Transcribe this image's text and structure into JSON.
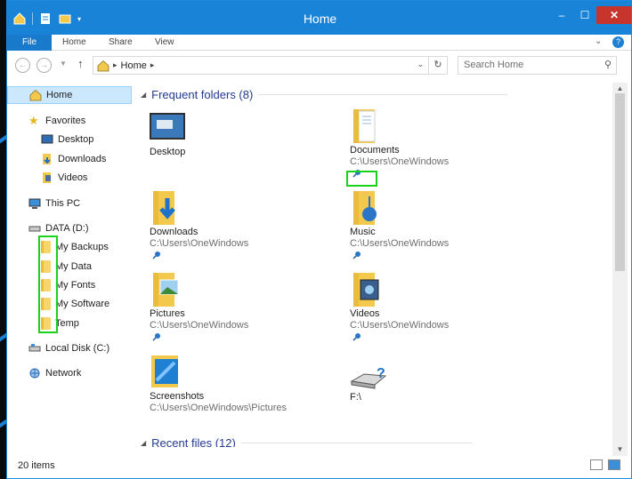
{
  "window": {
    "title": "Home",
    "controls": {
      "minimize": "–",
      "maximize": "☐",
      "close": "✕"
    }
  },
  "ribbon": {
    "tabs": [
      "File",
      "Home",
      "Share",
      "View"
    ],
    "help": "?"
  },
  "address": {
    "crumb": "Home",
    "search_placeholder": "Search Home"
  },
  "nav": {
    "items": [
      {
        "label": "Home",
        "icon": "home-icon",
        "selected": true
      },
      {
        "label": "Favorites",
        "icon": "star-icon"
      },
      {
        "label": "Desktop",
        "icon": "desktop-icon"
      },
      {
        "label": "Downloads",
        "icon": "downloads-folder-icon"
      },
      {
        "label": "Videos",
        "icon": "videos-folder-icon"
      },
      {
        "label": "This PC",
        "icon": "computer-icon"
      },
      {
        "label": "DATA (D:)",
        "icon": "drive-icon"
      },
      {
        "label": "My Backups",
        "icon": "folder-icon"
      },
      {
        "label": "My Data",
        "icon": "folder-icon"
      },
      {
        "label": "My Fonts",
        "icon": "folder-icon"
      },
      {
        "label": "My Software",
        "icon": "folder-icon"
      },
      {
        "label": "Temp",
        "icon": "folder-icon"
      },
      {
        "label": "Local Disk (C:)",
        "icon": "drive-icon"
      },
      {
        "label": "Network",
        "icon": "network-icon"
      }
    ]
  },
  "content": {
    "frequent_header": "Frequent folders (8)",
    "recent_header": "Recent files (12)",
    "tiles": [
      {
        "name": "Desktop",
        "path": "",
        "pinned": false,
        "icon": "desktop-icon"
      },
      {
        "name": "Documents",
        "path": "C:\\Users\\OneWindows",
        "pinned": true,
        "icon": "documents-folder-icon"
      },
      {
        "name": "Downloads",
        "path": "C:\\Users\\OneWindows",
        "pinned": true,
        "icon": "downloads-folder-icon"
      },
      {
        "name": "Music",
        "path": "C:\\Users\\OneWindows",
        "pinned": true,
        "icon": "music-folder-icon"
      },
      {
        "name": "Pictures",
        "path": "C:\\Users\\OneWindows",
        "pinned": true,
        "icon": "pictures-folder-icon"
      },
      {
        "name": "Videos",
        "path": "C:\\Users\\OneWindows",
        "pinned": true,
        "icon": "videos-folder-icon"
      },
      {
        "name": "Screenshots",
        "path": "C:\\Users\\OneWindows\\Pictures",
        "pinned": false,
        "icon": "screenshots-folder-icon"
      },
      {
        "name": "F:\\",
        "path": "",
        "pinned": false,
        "icon": "unknown-drive-icon"
      }
    ]
  },
  "status": {
    "count": "20 items"
  },
  "colors": {
    "accent": "#1883d7",
    "highlight": "#19d219",
    "header_text": "#233b91"
  }
}
